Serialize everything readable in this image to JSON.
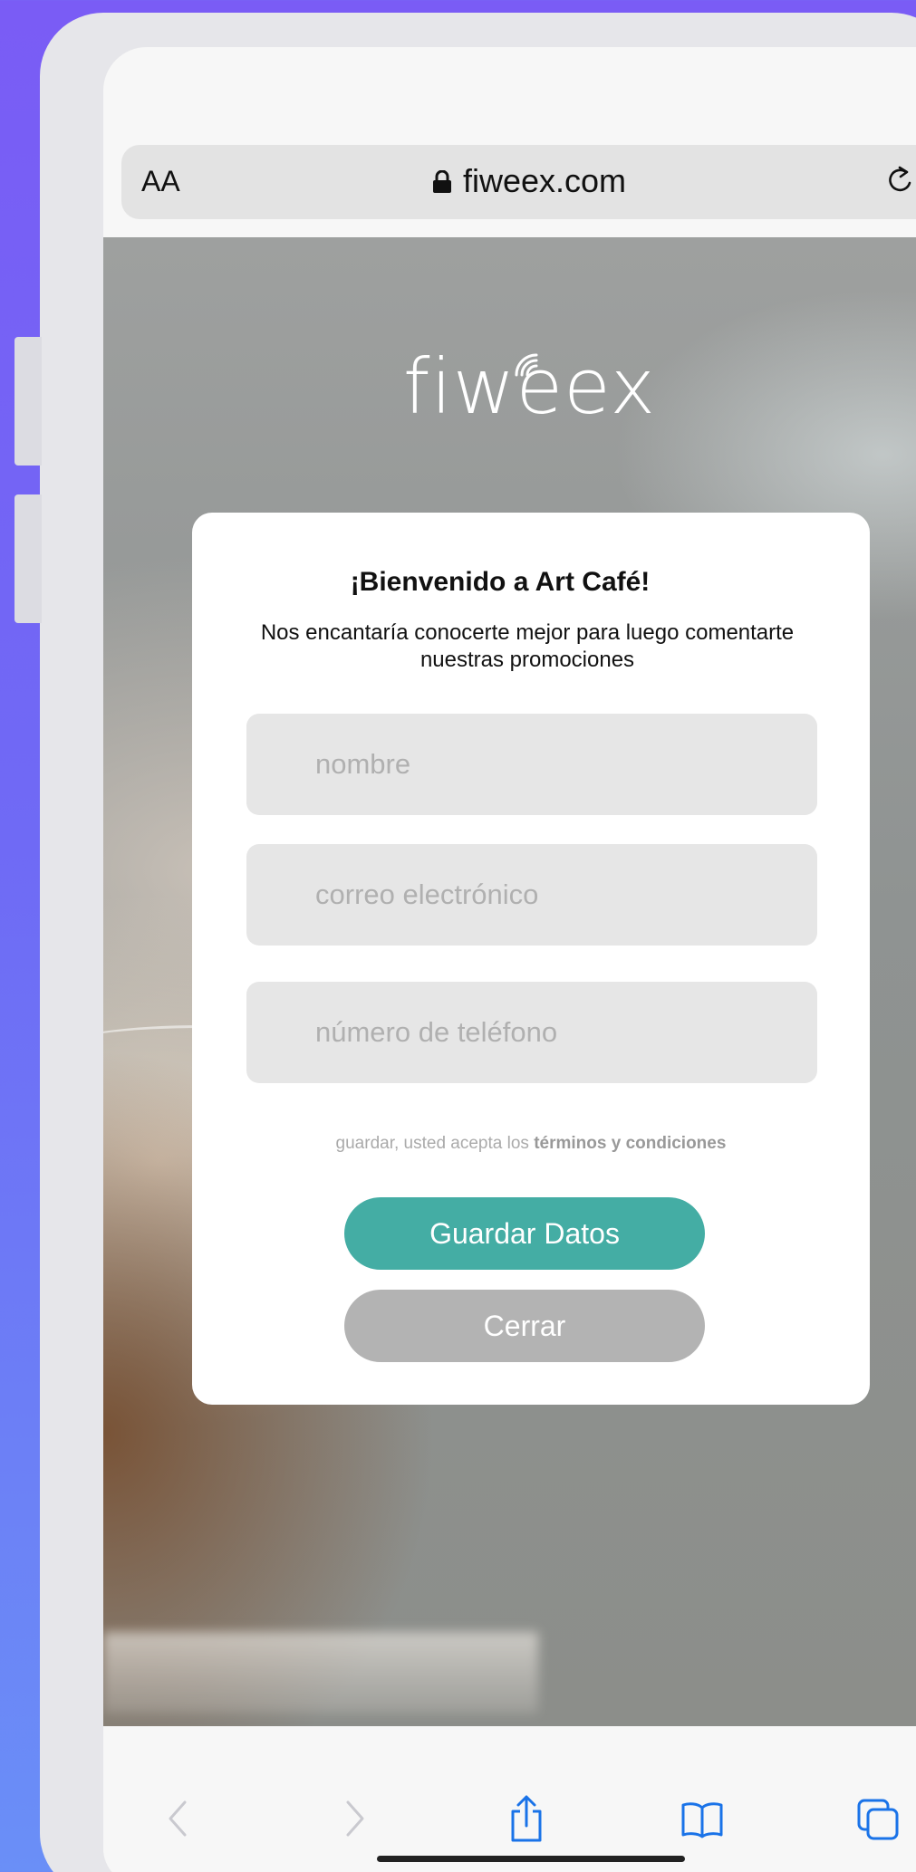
{
  "browser": {
    "text_size_label": "AA",
    "url": "fiweex.com",
    "colors": {
      "accent": "#1a73e8"
    }
  },
  "page": {
    "logo": "fiweex"
  },
  "modal": {
    "title": "¡Bienvenido a Art Café!",
    "subtitle": "Nos encantaría conocerte mejor para luego comentarte nuestras promociones",
    "fields": {
      "name_placeholder": "nombre",
      "email_placeholder": "correo electrónico",
      "phone_placeholder": "número de teléfono"
    },
    "terms_prefix": "guardar, usted acepta los",
    "terms_link": "términos y condiciones",
    "save_label": "Guardar Datos",
    "close_label": "Cerrar",
    "colors": {
      "save": "#44ada4",
      "close": "#b3b3b3"
    }
  },
  "toolbar": {
    "icons": [
      "back-icon",
      "forward-icon",
      "share-icon",
      "bookmarks-icon",
      "tabs-icon"
    ]
  }
}
